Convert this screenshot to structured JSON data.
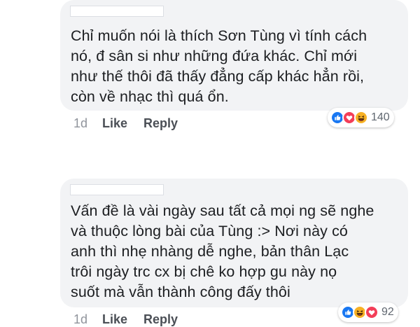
{
  "comments": [
    {
      "text": "Chỉ muốn nói là thích Sơn Tùng vì tính cách\nnó, đ sân si như những đứa khác. Chỉ mới\nnhư thế thôi đã thấy đẳng cấp khác hẳn rồi,\ncòn về nhạc thì quá ổn.",
      "reactions": [
        "like-icon",
        "love-icon",
        "haha-icon"
      ],
      "reaction_count": "140",
      "time": "1d",
      "like_label": "Like",
      "reply_label": "Reply"
    },
    {
      "text": "Vấn đề là vài ngày sau tất cả mọi ng sẽ nghe\nvà thuộc lòng bài của Tùng :> Nơi này có\nanh thì nhẹ nhàng dễ nghe,  bản thân Lạc\ntrôi ngày trc cx bị chê ko hợp gu này nọ\nsuốt mà vẫn thành công đấy thôi",
      "reactions": [
        "like-icon",
        "haha-icon",
        "love-icon"
      ],
      "reaction_count": "92",
      "time": "1d",
      "like_label": "Like",
      "reply_label": "Reply"
    }
  ],
  "colors": {
    "bubble": "#f2f3f5",
    "like": "#1877f2",
    "love": "#f33e58",
    "haha": "#f7b125",
    "meta": "#90949c",
    "action": "#4b4f56"
  }
}
